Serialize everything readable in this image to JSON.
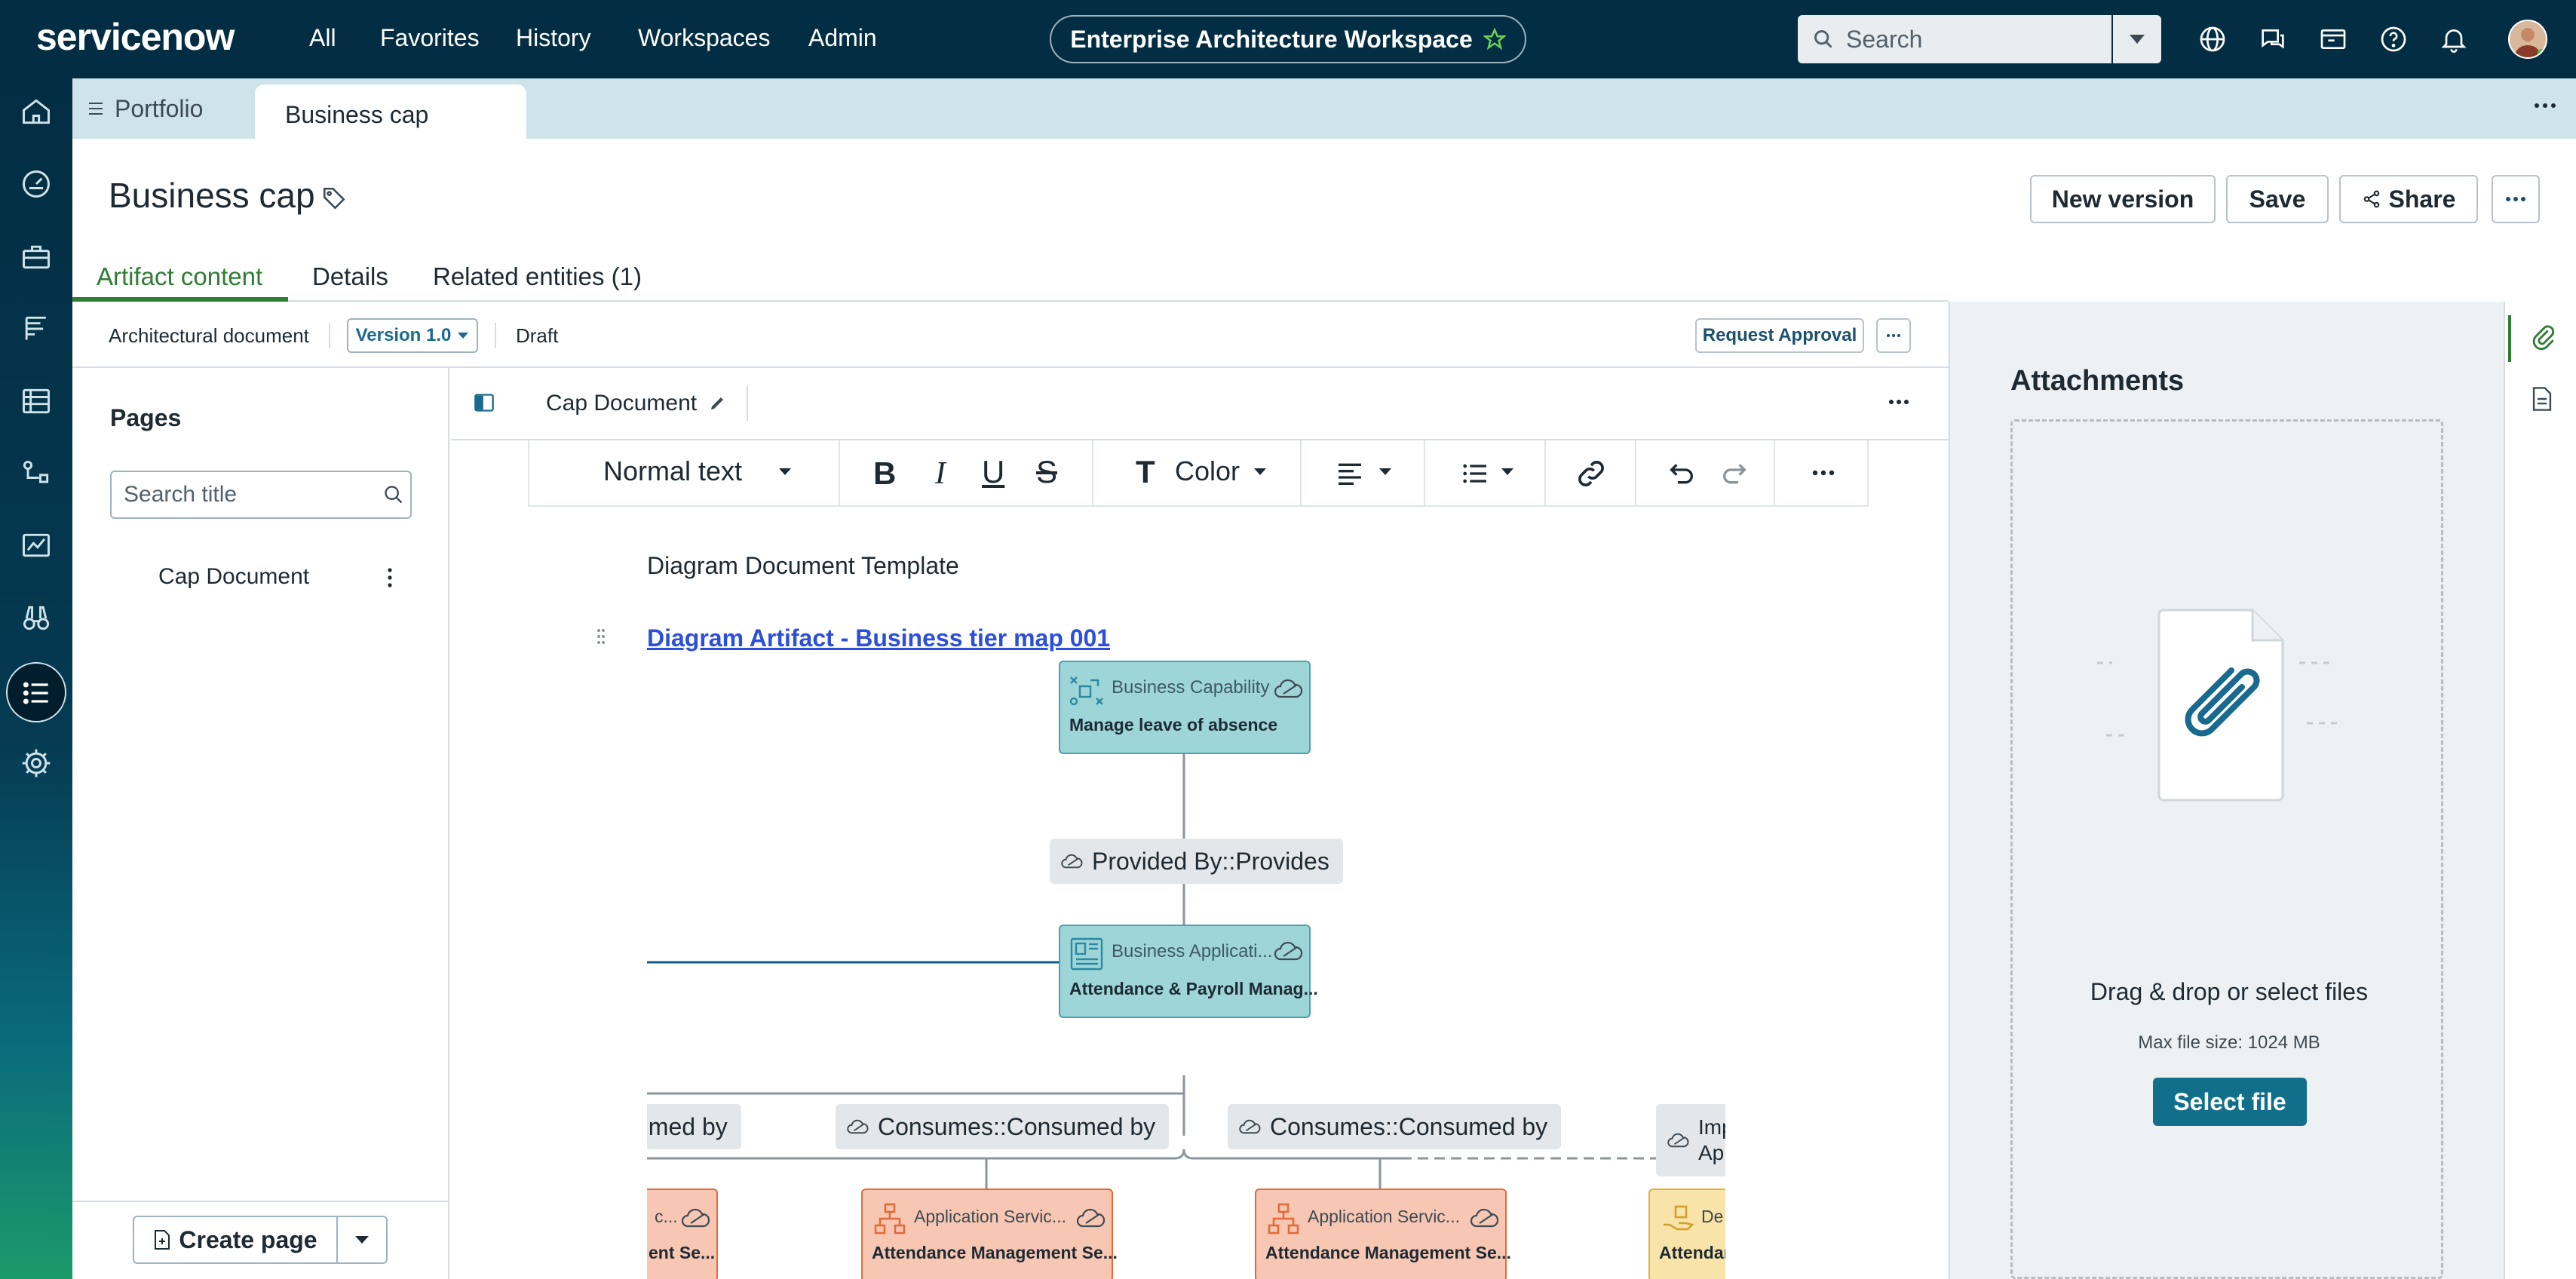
{
  "topnav": {
    "brand": "servicenow",
    "links": [
      "All",
      "Favorites",
      "History",
      "Workspaces",
      "Admin"
    ],
    "workspace": "Enterprise Architecture Workspace",
    "search_placeholder": "Search"
  },
  "tabs": {
    "portfolio": "Portfolio",
    "active": "Business cap"
  },
  "page": {
    "title": "Business cap",
    "buttons": {
      "new_version": "New version",
      "save": "Save",
      "share": "Share"
    },
    "subtabs": [
      "Artifact content",
      "Details",
      "Related entities (1)"
    ]
  },
  "docbar": {
    "type": "Architectural document",
    "version": "Version 1.0",
    "status": "Draft",
    "request": "Request Approval"
  },
  "pages": {
    "heading": "Pages",
    "search_placeholder": "Search title",
    "items": [
      "Cap Document"
    ],
    "create": "Create page"
  },
  "editor": {
    "doc_title": "Cap Document",
    "toolbar": {
      "style": "Normal text",
      "color": "Color"
    },
    "template_text": "Diagram Document Template",
    "link_text": "Diagram Artifact - Business tier map 001"
  },
  "diagram": {
    "capability": {
      "type": "Business Capability",
      "name": "Manage leave of absence"
    },
    "rel1": "Provided By::Provides",
    "application": {
      "type": "Business Applicati...",
      "name": "Attendance & Payroll Manag..."
    },
    "rels": [
      "umed by",
      "Consumes::Consumed by",
      "Consumes::Consumed by",
      "Imp",
      "Ap"
    ],
    "services": [
      {
        "type": "Application Servic...",
        "name": "Attendance Management Se..."
      },
      {
        "type": "Application Servic...",
        "name": "Attendance Management Se..."
      }
    ],
    "partial_left": {
      "type": "c...",
      "name": "ent Se..."
    },
    "partial_right": {
      "type": "De",
      "name": "Attendar"
    }
  },
  "attachments": {
    "heading": "Attachments",
    "drag": "Drag & drop or select files",
    "max": "Max file size: 1024 MB",
    "select": "Select file"
  },
  "colors": {
    "nav": "#032d42",
    "accent_green": "#2e7d32",
    "primary": "#126f8b",
    "teal_node": "#9ed5d9",
    "orange_node": "#f7c7b3"
  }
}
